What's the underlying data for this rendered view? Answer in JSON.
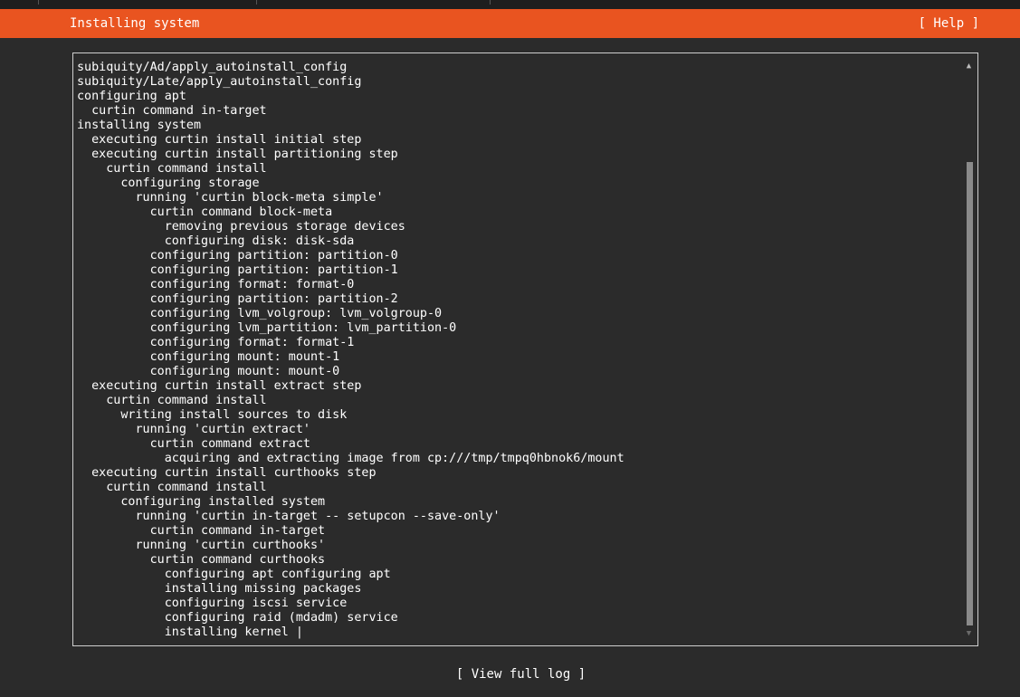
{
  "header": {
    "title": "Installing system",
    "help_label": "[ Help ]"
  },
  "log": {
    "lines": [
      "subiquity/Ad/apply_autoinstall_config",
      "subiquity/Late/apply_autoinstall_config",
      "configuring apt",
      "  curtin command in-target",
      "installing system",
      "  executing curtin install initial step",
      "  executing curtin install partitioning step",
      "    curtin command install",
      "      configuring storage",
      "        running 'curtin block-meta simple'",
      "          curtin command block-meta",
      "            removing previous storage devices",
      "            configuring disk: disk-sda",
      "          configuring partition: partition-0",
      "          configuring partition: partition-1",
      "          configuring format: format-0",
      "          configuring partition: partition-2",
      "          configuring lvm_volgroup: lvm_volgroup-0",
      "          configuring lvm_partition: lvm_partition-0",
      "          configuring format: format-1",
      "          configuring mount: mount-1",
      "          configuring mount: mount-0",
      "  executing curtin install extract step",
      "    curtin command install",
      "      writing install sources to disk",
      "        running 'curtin extract'",
      "          curtin command extract",
      "            acquiring and extracting image from cp:///tmp/tmpq0hbnok6/mount",
      "  executing curtin install curthooks step",
      "    curtin command install",
      "      configuring installed system",
      "        running 'curtin in-target -- setupcon --save-only'",
      "          curtin command in-target",
      "        running 'curtin curthooks'",
      "          curtin command curthooks",
      "            configuring apt configuring apt",
      "            installing missing packages",
      "            configuring iscsi service",
      "            configuring raid (mdadm) service",
      "            installing kernel"
    ],
    "spinner": "|"
  },
  "scrollbar": {
    "up_arrow": "▲",
    "down_arrow": "▼"
  },
  "footer": {
    "view_log_label": "[ View full log ]"
  },
  "colors": {
    "accent": "#e95420",
    "background": "#2b2b2b",
    "text": "#ffffff"
  }
}
